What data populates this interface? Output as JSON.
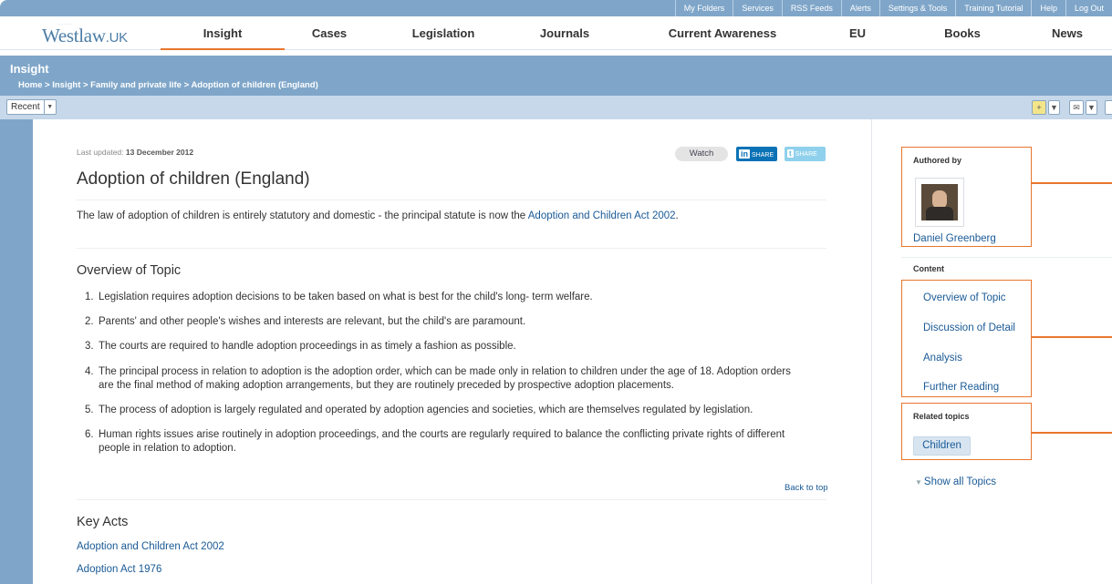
{
  "util_links": [
    "My Folders",
    "Services",
    "RSS Feeds",
    "Alerts",
    "Settings & Tools",
    "Training Tutorial",
    "Help",
    "Log Out"
  ],
  "logo": {
    "name": "Westlaw",
    "suffix": "UK"
  },
  "nav": {
    "items": [
      "Insight",
      "Cases",
      "Legislation",
      "Journals",
      "Current Awareness",
      "EU",
      "Books",
      "News"
    ],
    "active": "Insight"
  },
  "breadcrumb": {
    "title": "Insight",
    "path": "Home > Insight > Family and private life > Adoption of children (England)"
  },
  "toolbar": {
    "recent_label": "Recent"
  },
  "article": {
    "updated_label": "Last updated:",
    "updated_date": "13 December 2012",
    "watch_label": "Watch",
    "linkedin_label": "SHARE",
    "twitter_label": "SHARE",
    "title": "Adoption of children (England)",
    "intro_text": "The law of adoption of children is entirely statutory and domestic - the principal statute is now the ",
    "intro_link": "Adoption and Children Act 2002",
    "intro_end": ".",
    "overview_heading": "Overview of Topic",
    "overview_items": [
      {
        "num": "1.",
        "text": "Legislation requires adoption decisions to be taken based on what is best for the child's long- term welfare."
      },
      {
        "num": "2.",
        "text": "Parents' and other people's wishes and interests are relevant, but the child's are paramount."
      },
      {
        "num": "3.",
        "text": "The courts are required to handle adoption proceedings in as timely a fashion as possible."
      },
      {
        "num": "4.",
        "text": "The principal process in relation to adoption is the adoption order, which can be made only in relation to children under the age of 18. Adoption orders are the final method of making adoption arrangements, but they are routinely preceded by prospective adoption placements."
      },
      {
        "num": "5.",
        "text": "The process of adoption is largely regulated and operated by adoption agencies and societies, which are themselves regulated by legislation."
      },
      {
        "num": "6.",
        "text": "Human rights issues arise routinely in adoption proceedings, and the courts are regularly required to balance the conflicting private rights of different people in relation to adoption."
      }
    ],
    "back_to_top": "Back to top",
    "key_acts_heading": "Key Acts",
    "key_acts": [
      "Adoption and Children Act 2002",
      "Adoption Act 1976"
    ]
  },
  "sidebar": {
    "authored_by": "Authored by",
    "author_name": "Daniel Greenberg",
    "content_heading": "Content",
    "content_links": [
      "Overview of Topic",
      "Discussion of Detail",
      "Analysis",
      "Further Reading"
    ],
    "related_heading": "Related topics",
    "related_topics": [
      "Children"
    ],
    "show_all": "Show all Topics"
  },
  "colors": {
    "brand_blue": "#7fa6c9",
    "highlight_orange": "#e8762d",
    "link_blue": "#1a5a96"
  }
}
